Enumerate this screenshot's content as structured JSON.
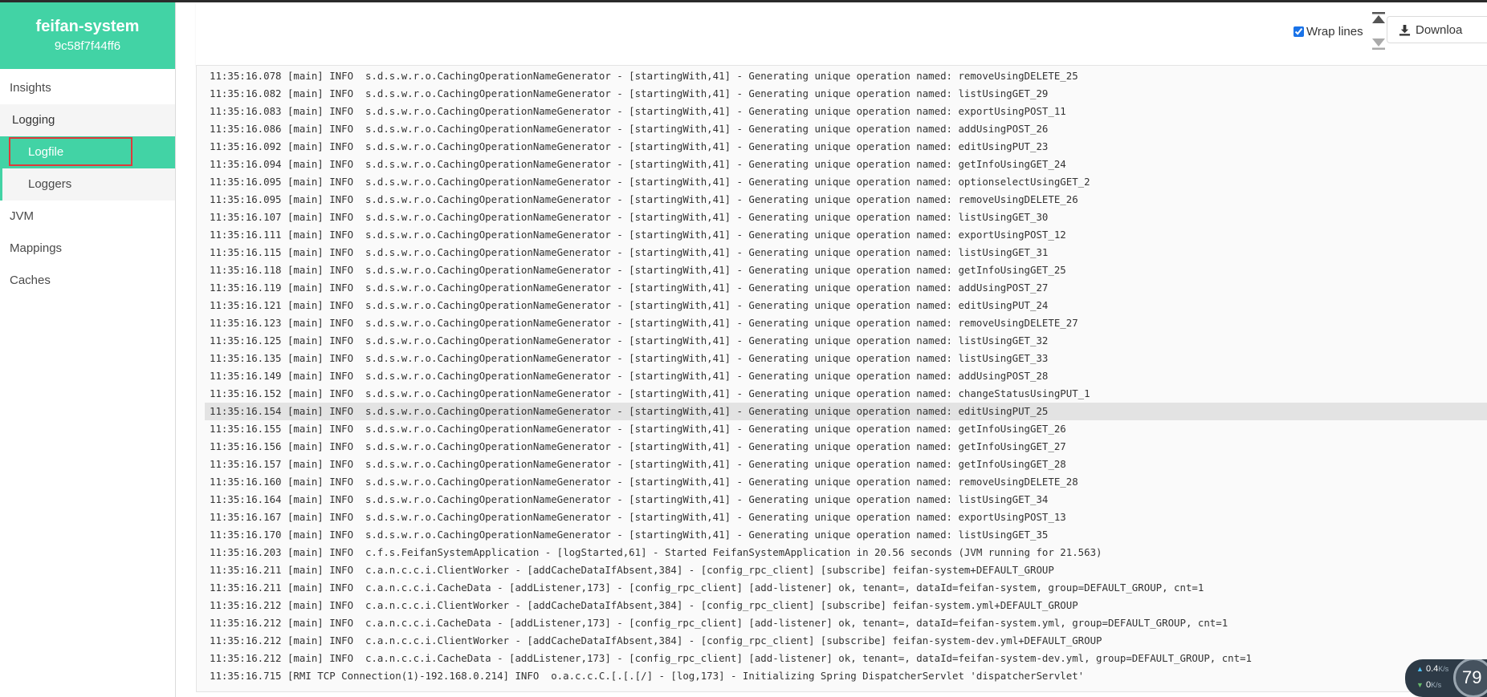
{
  "app": {
    "name": "feifan-system",
    "instance_id": "9c58f7f44ff6"
  },
  "sidebar": {
    "insights": "Insights",
    "logging": "Logging",
    "logfile": "Logfile",
    "loggers": "Loggers",
    "jvm": "JVM",
    "mappings": "Mappings",
    "caches": "Caches"
  },
  "toolbar": {
    "wrap_label": "Wrap lines",
    "wrap_checked": true,
    "download_label": "Downloa"
  },
  "log_lines": [
    "11:35:16.078 [main] INFO  s.d.s.w.r.o.CachingOperationNameGenerator - [startingWith,41] - Generating unique operation named: removeUsingDELETE_25",
    "11:35:16.082 [main] INFO  s.d.s.w.r.o.CachingOperationNameGenerator - [startingWith,41] - Generating unique operation named: listUsingGET_29",
    "11:35:16.083 [main] INFO  s.d.s.w.r.o.CachingOperationNameGenerator - [startingWith,41] - Generating unique operation named: exportUsingPOST_11",
    "11:35:16.086 [main] INFO  s.d.s.w.r.o.CachingOperationNameGenerator - [startingWith,41] - Generating unique operation named: addUsingPOST_26",
    "11:35:16.092 [main] INFO  s.d.s.w.r.o.CachingOperationNameGenerator - [startingWith,41] - Generating unique operation named: editUsingPUT_23",
    "11:35:16.094 [main] INFO  s.d.s.w.r.o.CachingOperationNameGenerator - [startingWith,41] - Generating unique operation named: getInfoUsingGET_24",
    "11:35:16.095 [main] INFO  s.d.s.w.r.o.CachingOperationNameGenerator - [startingWith,41] - Generating unique operation named: optionselectUsingGET_2",
    "11:35:16.095 [main] INFO  s.d.s.w.r.o.CachingOperationNameGenerator - [startingWith,41] - Generating unique operation named: removeUsingDELETE_26",
    "11:35:16.107 [main] INFO  s.d.s.w.r.o.CachingOperationNameGenerator - [startingWith,41] - Generating unique operation named: listUsingGET_30",
    "11:35:16.111 [main] INFO  s.d.s.w.r.o.CachingOperationNameGenerator - [startingWith,41] - Generating unique operation named: exportUsingPOST_12",
    "11:35:16.115 [main] INFO  s.d.s.w.r.o.CachingOperationNameGenerator - [startingWith,41] - Generating unique operation named: listUsingGET_31",
    "11:35:16.118 [main] INFO  s.d.s.w.r.o.CachingOperationNameGenerator - [startingWith,41] - Generating unique operation named: getInfoUsingGET_25",
    "11:35:16.119 [main] INFO  s.d.s.w.r.o.CachingOperationNameGenerator - [startingWith,41] - Generating unique operation named: addUsingPOST_27",
    "11:35:16.121 [main] INFO  s.d.s.w.r.o.CachingOperationNameGenerator - [startingWith,41] - Generating unique operation named: editUsingPUT_24",
    "11:35:16.123 [main] INFO  s.d.s.w.r.o.CachingOperationNameGenerator - [startingWith,41] - Generating unique operation named: removeUsingDELETE_27",
    "11:35:16.125 [main] INFO  s.d.s.w.r.o.CachingOperationNameGenerator - [startingWith,41] - Generating unique operation named: listUsingGET_32",
    "11:35:16.135 [main] INFO  s.d.s.w.r.o.CachingOperationNameGenerator - [startingWith,41] - Generating unique operation named: listUsingGET_33",
    "11:35:16.149 [main] INFO  s.d.s.w.r.o.CachingOperationNameGenerator - [startingWith,41] - Generating unique operation named: addUsingPOST_28",
    "11:35:16.152 [main] INFO  s.d.s.w.r.o.CachingOperationNameGenerator - [startingWith,41] - Generating unique operation named: changeStatusUsingPUT_1",
    "11:35:16.154 [main] INFO  s.d.s.w.r.o.CachingOperationNameGenerator - [startingWith,41] - Generating unique operation named: editUsingPUT_25",
    "11:35:16.155 [main] INFO  s.d.s.w.r.o.CachingOperationNameGenerator - [startingWith,41] - Generating unique operation named: getInfoUsingGET_26",
    "11:35:16.156 [main] INFO  s.d.s.w.r.o.CachingOperationNameGenerator - [startingWith,41] - Generating unique operation named: getInfoUsingGET_27",
    "11:35:16.157 [main] INFO  s.d.s.w.r.o.CachingOperationNameGenerator - [startingWith,41] - Generating unique operation named: getInfoUsingGET_28",
    "11:35:16.160 [main] INFO  s.d.s.w.r.o.CachingOperationNameGenerator - [startingWith,41] - Generating unique operation named: removeUsingDELETE_28",
    "11:35:16.164 [main] INFO  s.d.s.w.r.o.CachingOperationNameGenerator - [startingWith,41] - Generating unique operation named: listUsingGET_34",
    "11:35:16.167 [main] INFO  s.d.s.w.r.o.CachingOperationNameGenerator - [startingWith,41] - Generating unique operation named: exportUsingPOST_13",
    "11:35:16.170 [main] INFO  s.d.s.w.r.o.CachingOperationNameGenerator - [startingWith,41] - Generating unique operation named: listUsingGET_35",
    "11:35:16.203 [main] INFO  c.f.s.FeifanSystemApplication - [logStarted,61] - Started FeifanSystemApplication in 20.56 seconds (JVM running for 21.563)",
    "11:35:16.211 [main] INFO  c.a.n.c.c.i.ClientWorker - [addCacheDataIfAbsent,384] - [config_rpc_client] [subscribe] feifan-system+DEFAULT_GROUP",
    "11:35:16.211 [main] INFO  c.a.n.c.c.i.CacheData - [addListener,173] - [config_rpc_client] [add-listener] ok, tenant=, dataId=feifan-system, group=DEFAULT_GROUP, cnt=1",
    "11:35:16.212 [main] INFO  c.a.n.c.c.i.ClientWorker - [addCacheDataIfAbsent,384] - [config_rpc_client] [subscribe] feifan-system.yml+DEFAULT_GROUP",
    "11:35:16.212 [main] INFO  c.a.n.c.c.i.CacheData - [addListener,173] - [config_rpc_client] [add-listener] ok, tenant=, dataId=feifan-system.yml, group=DEFAULT_GROUP, cnt=1",
    "11:35:16.212 [main] INFO  c.a.n.c.c.i.ClientWorker - [addCacheDataIfAbsent,384] - [config_rpc_client] [subscribe] feifan-system-dev.yml+DEFAULT_GROUP",
    "11:35:16.212 [main] INFO  c.a.n.c.c.i.CacheData - [addListener,173] - [config_rpc_client] [add-listener] ok, tenant=, dataId=feifan-system-dev.yml, group=DEFAULT_GROUP, cnt=1",
    "11:35:16.715 [RMI TCP Connection(1)-192.168.0.214] INFO  o.a.c.c.C.[.[.[/] - [log,173] - Initializing Spring DispatcherServlet 'dispatcherServlet'"
  ],
  "highlighted_line": 19,
  "net_widget": {
    "up": "0.4",
    "down": "0",
    "unit": "K/s",
    "circle_value": "79"
  },
  "colors": {
    "accent": "#42d3a5",
    "highlight_box": "#e0393a"
  }
}
